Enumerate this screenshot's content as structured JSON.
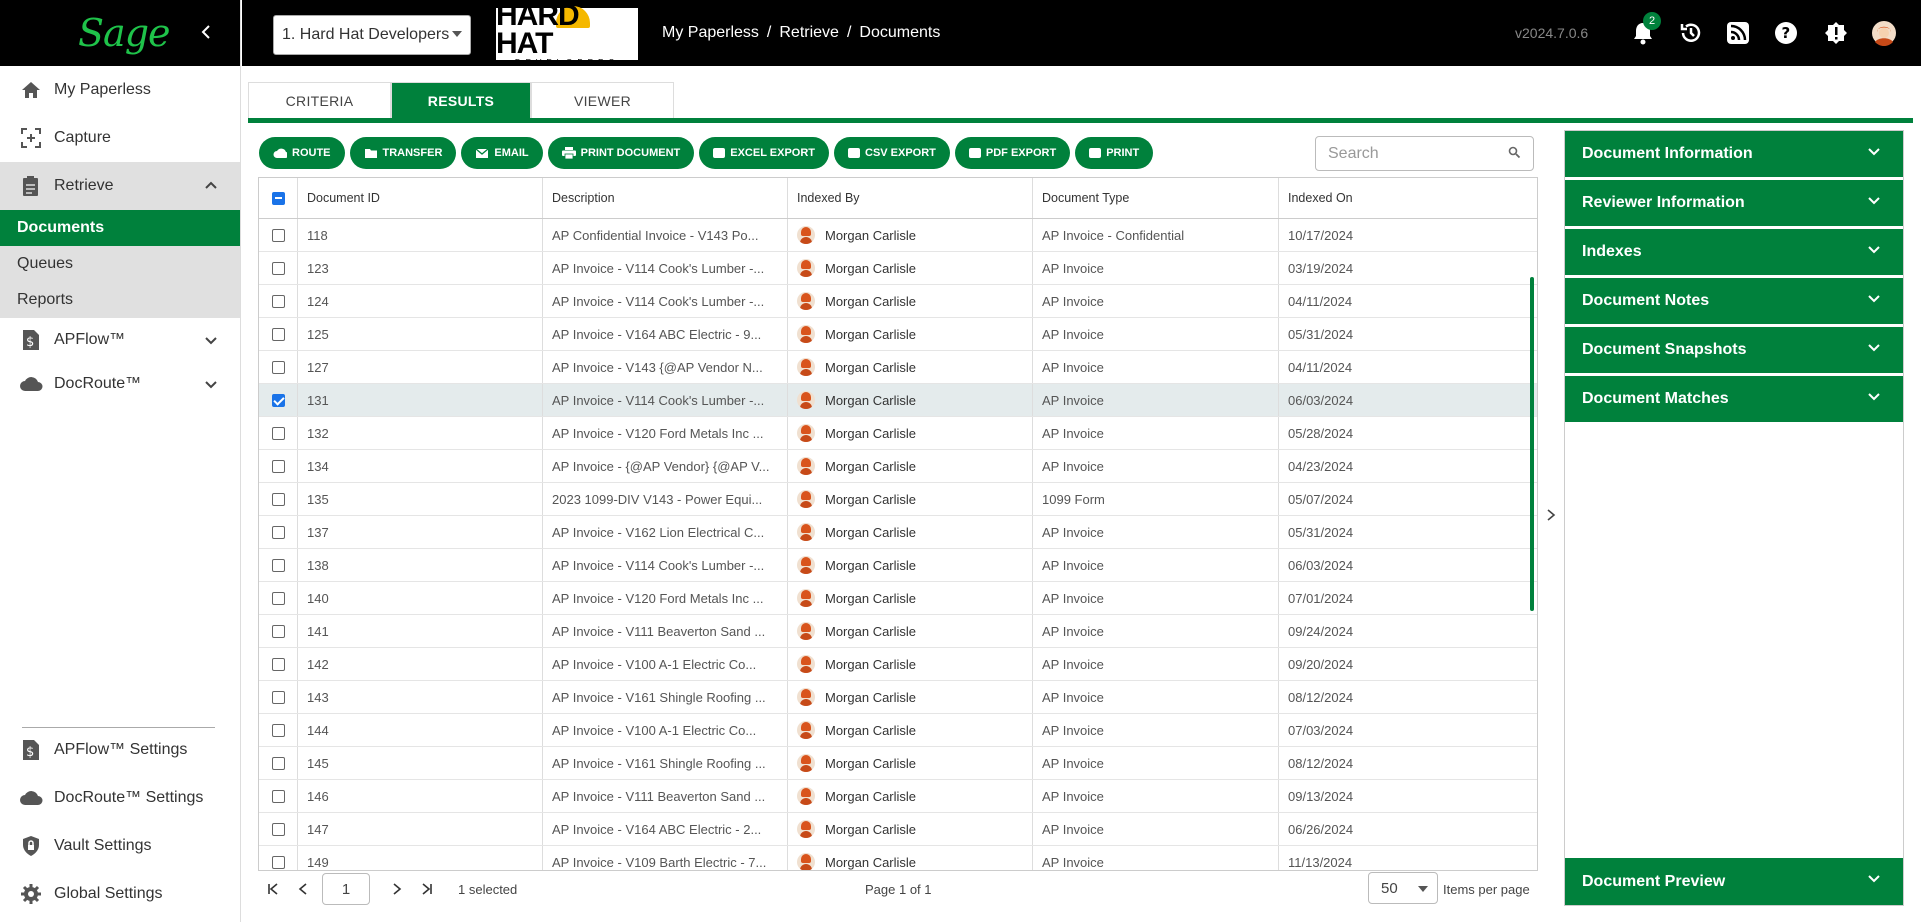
{
  "sidebar": {
    "brand": "Sage",
    "items": [
      {
        "label": "My Paperless",
        "icon": "home-icon"
      },
      {
        "label": "Capture",
        "icon": "capture-icon"
      },
      {
        "label": "Retrieve",
        "icon": "retrieve-icon"
      }
    ],
    "retrieve_sub": [
      "Documents",
      "Queues",
      "Reports"
    ],
    "apflow": "APFlow™",
    "docroute": "DocRoute™",
    "settings": [
      {
        "label": "APFlow™ Settings",
        "icon": "dollar-doc-icon"
      },
      {
        "label": "DocRoute™ Settings",
        "icon": "cloud-icon"
      },
      {
        "label": "Vault Settings",
        "icon": "shield-lock-icon"
      },
      {
        "label": "Global Settings",
        "icon": "gear-icon"
      }
    ]
  },
  "header": {
    "company": "1. Hard Hat Developers",
    "logo_text": "HARD HAT",
    "logo_sub": "DEVELOPERS",
    "breadcrumb": [
      "My Paperless",
      "/",
      "Retrieve",
      "/",
      "Documents"
    ],
    "version": "v2024.7.0.6",
    "notification_count": "2"
  },
  "tabs": [
    "CRITERIA",
    "RESULTS",
    "VIEWER"
  ],
  "toolbar": {
    "route": "ROUTE",
    "transfer": "TRANSFER",
    "email": "EMAIL",
    "print_document": "PRINT DOCUMENT",
    "excel": "EXCEL EXPORT",
    "csv": "CSV EXPORT",
    "pdf": "PDF EXPORT",
    "print": "PRINT"
  },
  "search": {
    "placeholder": "Search"
  },
  "grid": {
    "columns": [
      "Document ID",
      "Description",
      "Indexed By",
      "Document Type",
      "Indexed On"
    ],
    "rows": [
      {
        "id": "118",
        "desc": "AP Confidential Invoice - V143 Po...",
        "by": "Morgan Carlisle",
        "type": "AP Invoice - Confidential",
        "on": "10/17/2024",
        "sel": false
      },
      {
        "id": "123",
        "desc": "AP Invoice - V114 Cook's Lumber -...",
        "by": "Morgan Carlisle",
        "type": "AP Invoice",
        "on": "03/19/2024",
        "sel": false
      },
      {
        "id": "124",
        "desc": "AP Invoice - V114 Cook's Lumber -...",
        "by": "Morgan Carlisle",
        "type": "AP Invoice",
        "on": "04/11/2024",
        "sel": false
      },
      {
        "id": "125",
        "desc": "AP Invoice - V164 ABC Electric - 9...",
        "by": "Morgan Carlisle",
        "type": "AP Invoice",
        "on": "05/31/2024",
        "sel": false
      },
      {
        "id": "127",
        "desc": "AP Invoice - V143 {@AP Vendor N...",
        "by": "Morgan Carlisle",
        "type": "AP Invoice",
        "on": "04/11/2024",
        "sel": false
      },
      {
        "id": "131",
        "desc": "AP Invoice - V114 Cook's Lumber -...",
        "by": "Morgan Carlisle",
        "type": "AP Invoice",
        "on": "06/03/2024",
        "sel": true
      },
      {
        "id": "132",
        "desc": "AP Invoice - V120 Ford Metals Inc ...",
        "by": "Morgan Carlisle",
        "type": "AP Invoice",
        "on": "05/28/2024",
        "sel": false
      },
      {
        "id": "134",
        "desc": "AP Invoice - {@AP Vendor} {@AP V...",
        "by": "Morgan Carlisle",
        "type": "AP Invoice",
        "on": "04/23/2024",
        "sel": false
      },
      {
        "id": "135",
        "desc": "2023 1099-DIV V143 - Power Equi...",
        "by": "Morgan Carlisle",
        "type": "1099 Form",
        "on": "05/07/2024",
        "sel": false
      },
      {
        "id": "137",
        "desc": "AP Invoice - V162 Lion Electrical C...",
        "by": "Morgan Carlisle",
        "type": "AP Invoice",
        "on": "05/31/2024",
        "sel": false
      },
      {
        "id": "138",
        "desc": "AP Invoice - V114 Cook's Lumber -...",
        "by": "Morgan Carlisle",
        "type": "AP Invoice",
        "on": "06/03/2024",
        "sel": false
      },
      {
        "id": "140",
        "desc": "AP Invoice - V120 Ford Metals Inc ...",
        "by": "Morgan Carlisle",
        "type": "AP Invoice",
        "on": "07/01/2024",
        "sel": false
      },
      {
        "id": "141",
        "desc": "AP Invoice - V111 Beaverton Sand ...",
        "by": "Morgan Carlisle",
        "type": "AP Invoice",
        "on": "09/24/2024",
        "sel": false
      },
      {
        "id": "142",
        "desc": "AP Invoice - V100 A-1 Electric Co...",
        "by": "Morgan Carlisle",
        "type": "AP Invoice",
        "on": "09/20/2024",
        "sel": false
      },
      {
        "id": "143",
        "desc": "AP Invoice - V161 Shingle Roofing ...",
        "by": "Morgan Carlisle",
        "type": "AP Invoice",
        "on": "08/12/2024",
        "sel": false
      },
      {
        "id": "144",
        "desc": "AP Invoice - V100 A-1 Electric Co...",
        "by": "Morgan Carlisle",
        "type": "AP Invoice",
        "on": "07/03/2024",
        "sel": false
      },
      {
        "id": "145",
        "desc": "AP Invoice - V161 Shingle Roofing ...",
        "by": "Morgan Carlisle",
        "type": "AP Invoice",
        "on": "08/12/2024",
        "sel": false
      },
      {
        "id": "146",
        "desc": "AP Invoice - V111 Beaverton Sand ...",
        "by": "Morgan Carlisle",
        "type": "AP Invoice",
        "on": "09/13/2024",
        "sel": false
      },
      {
        "id": "147",
        "desc": "AP Invoice - V164 ABC Electric - 2...",
        "by": "Morgan Carlisle",
        "type": "AP Invoice",
        "on": "06/26/2024",
        "sel": false
      },
      {
        "id": "149",
        "desc": "AP Invoice - V109 Barth Electric - 7...",
        "by": "Morgan Carlisle",
        "type": "AP Invoice",
        "on": "11/13/2024",
        "sel": false
      }
    ]
  },
  "pager": {
    "page": "1",
    "selected": "1 selected",
    "page_info": "Page 1 of 1",
    "items_per_page": "50",
    "items_per_page_label": "Items per page"
  },
  "right_panel": {
    "sections": [
      "Document Information",
      "Reviewer Information",
      "Indexes",
      "Document Notes",
      "Document Snapshots",
      "Document Matches"
    ],
    "preview": "Document Preview"
  },
  "colors": {
    "accent": "#00813c",
    "brand_green": "#1fc34a",
    "topbar": "#000000"
  }
}
